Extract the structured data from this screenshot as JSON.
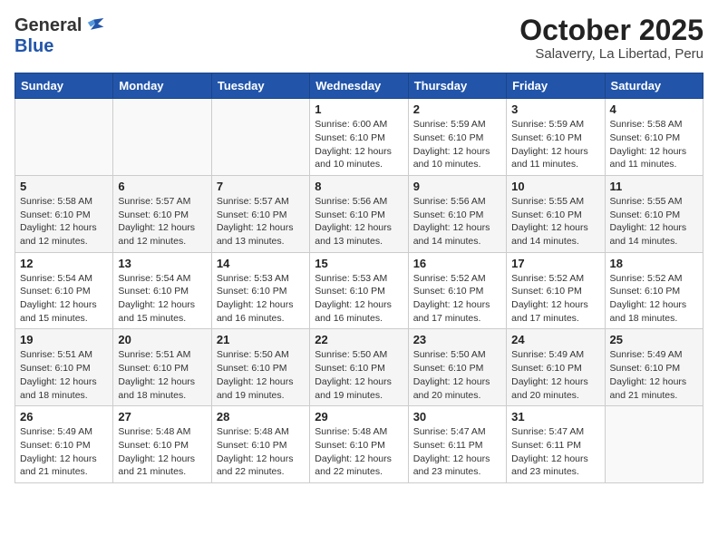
{
  "header": {
    "logo_general": "General",
    "logo_blue": "Blue",
    "month_title": "October 2025",
    "subtitle": "Salaverry, La Libertad, Peru"
  },
  "calendar": {
    "days_of_week": [
      "Sunday",
      "Monday",
      "Tuesday",
      "Wednesday",
      "Thursday",
      "Friday",
      "Saturday"
    ],
    "weeks": [
      [
        {
          "day": "",
          "info": ""
        },
        {
          "day": "",
          "info": ""
        },
        {
          "day": "",
          "info": ""
        },
        {
          "day": "1",
          "info": "Sunrise: 6:00 AM\nSunset: 6:10 PM\nDaylight: 12 hours\nand 10 minutes."
        },
        {
          "day": "2",
          "info": "Sunrise: 5:59 AM\nSunset: 6:10 PM\nDaylight: 12 hours\nand 10 minutes."
        },
        {
          "day": "3",
          "info": "Sunrise: 5:59 AM\nSunset: 6:10 PM\nDaylight: 12 hours\nand 11 minutes."
        },
        {
          "day": "4",
          "info": "Sunrise: 5:58 AM\nSunset: 6:10 PM\nDaylight: 12 hours\nand 11 minutes."
        }
      ],
      [
        {
          "day": "5",
          "info": "Sunrise: 5:58 AM\nSunset: 6:10 PM\nDaylight: 12 hours\nand 12 minutes."
        },
        {
          "day": "6",
          "info": "Sunrise: 5:57 AM\nSunset: 6:10 PM\nDaylight: 12 hours\nand 12 minutes."
        },
        {
          "day": "7",
          "info": "Sunrise: 5:57 AM\nSunset: 6:10 PM\nDaylight: 12 hours\nand 13 minutes."
        },
        {
          "day": "8",
          "info": "Sunrise: 5:56 AM\nSunset: 6:10 PM\nDaylight: 12 hours\nand 13 minutes."
        },
        {
          "day": "9",
          "info": "Sunrise: 5:56 AM\nSunset: 6:10 PM\nDaylight: 12 hours\nand 14 minutes."
        },
        {
          "day": "10",
          "info": "Sunrise: 5:55 AM\nSunset: 6:10 PM\nDaylight: 12 hours\nand 14 minutes."
        },
        {
          "day": "11",
          "info": "Sunrise: 5:55 AM\nSunset: 6:10 PM\nDaylight: 12 hours\nand 14 minutes."
        }
      ],
      [
        {
          "day": "12",
          "info": "Sunrise: 5:54 AM\nSunset: 6:10 PM\nDaylight: 12 hours\nand 15 minutes."
        },
        {
          "day": "13",
          "info": "Sunrise: 5:54 AM\nSunset: 6:10 PM\nDaylight: 12 hours\nand 15 minutes."
        },
        {
          "day": "14",
          "info": "Sunrise: 5:53 AM\nSunset: 6:10 PM\nDaylight: 12 hours\nand 16 minutes."
        },
        {
          "day": "15",
          "info": "Sunrise: 5:53 AM\nSunset: 6:10 PM\nDaylight: 12 hours\nand 16 minutes."
        },
        {
          "day": "16",
          "info": "Sunrise: 5:52 AM\nSunset: 6:10 PM\nDaylight: 12 hours\nand 17 minutes."
        },
        {
          "day": "17",
          "info": "Sunrise: 5:52 AM\nSunset: 6:10 PM\nDaylight: 12 hours\nand 17 minutes."
        },
        {
          "day": "18",
          "info": "Sunrise: 5:52 AM\nSunset: 6:10 PM\nDaylight: 12 hours\nand 18 minutes."
        }
      ],
      [
        {
          "day": "19",
          "info": "Sunrise: 5:51 AM\nSunset: 6:10 PM\nDaylight: 12 hours\nand 18 minutes."
        },
        {
          "day": "20",
          "info": "Sunrise: 5:51 AM\nSunset: 6:10 PM\nDaylight: 12 hours\nand 18 minutes."
        },
        {
          "day": "21",
          "info": "Sunrise: 5:50 AM\nSunset: 6:10 PM\nDaylight: 12 hours\nand 19 minutes."
        },
        {
          "day": "22",
          "info": "Sunrise: 5:50 AM\nSunset: 6:10 PM\nDaylight: 12 hours\nand 19 minutes."
        },
        {
          "day": "23",
          "info": "Sunrise: 5:50 AM\nSunset: 6:10 PM\nDaylight: 12 hours\nand 20 minutes."
        },
        {
          "day": "24",
          "info": "Sunrise: 5:49 AM\nSunset: 6:10 PM\nDaylight: 12 hours\nand 20 minutes."
        },
        {
          "day": "25",
          "info": "Sunrise: 5:49 AM\nSunset: 6:10 PM\nDaylight: 12 hours\nand 21 minutes."
        }
      ],
      [
        {
          "day": "26",
          "info": "Sunrise: 5:49 AM\nSunset: 6:10 PM\nDaylight: 12 hours\nand 21 minutes."
        },
        {
          "day": "27",
          "info": "Sunrise: 5:48 AM\nSunset: 6:10 PM\nDaylight: 12 hours\nand 21 minutes."
        },
        {
          "day": "28",
          "info": "Sunrise: 5:48 AM\nSunset: 6:10 PM\nDaylight: 12 hours\nand 22 minutes."
        },
        {
          "day": "29",
          "info": "Sunrise: 5:48 AM\nSunset: 6:10 PM\nDaylight: 12 hours\nand 22 minutes."
        },
        {
          "day": "30",
          "info": "Sunrise: 5:47 AM\nSunset: 6:11 PM\nDaylight: 12 hours\nand 23 minutes."
        },
        {
          "day": "31",
          "info": "Sunrise: 5:47 AM\nSunset: 6:11 PM\nDaylight: 12 hours\nand 23 minutes."
        },
        {
          "day": "",
          "info": ""
        }
      ]
    ]
  }
}
